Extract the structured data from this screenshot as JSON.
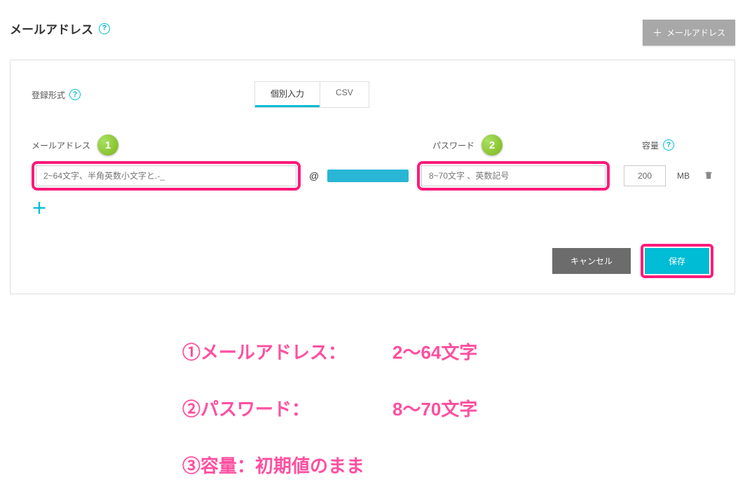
{
  "header": {
    "title": "メールアドレス",
    "add_button_label": "メールアドレス"
  },
  "panel": {
    "reg_format_label": "登録形式",
    "tabs": {
      "individual": "個別入力",
      "csv": "CSV"
    },
    "labels": {
      "email": "メールアドレス",
      "password": "パスワード",
      "capacity": "容量"
    },
    "badges": {
      "one": "1",
      "two": "2"
    },
    "inputs": {
      "email_placeholder": "2~64文字、半角英数小文字と.-_",
      "at": "@",
      "password_placeholder": "8~70文字 、英数記号",
      "capacity_value": "200",
      "capacity_unit": "MB"
    },
    "buttons": {
      "cancel": "キャンセル",
      "save": "保存"
    }
  },
  "annotations": {
    "line1_left": "①メールアドレス：",
    "line1_right": "2～64文字",
    "line2_left": "②パスワード：",
    "line2_right": "8～70文字",
    "line3": "③容量：初期値のまま"
  }
}
